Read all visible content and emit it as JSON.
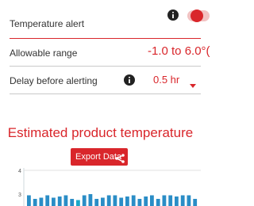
{
  "settings": {
    "alert_label": "Temperature alert",
    "alert_enabled": true,
    "range_label": "Allowable range",
    "range_value": "-1.0 to 6.0°(",
    "delay_label": "Delay before alerting",
    "delay_value": "0.5 hr"
  },
  "chart_section": {
    "title": "Estimated product temperature",
    "export_label": "Export Data"
  },
  "colors": {
    "accent": "#d9262b",
    "bar": "#2a8dc6",
    "bar_low": "#1aa8c8",
    "divider": "#c9c9c9"
  },
  "icons": {
    "info": "info-icon",
    "share": "share-icon",
    "caret": "chevron-down-icon"
  },
  "chart_data": {
    "type": "bar",
    "yticks": [
      "4",
      "3"
    ],
    "ylim": [
      2.7,
      4.2
    ],
    "values": [
      2.95,
      2.8,
      2.85,
      2.95,
      2.85,
      2.9,
      2.95,
      2.8,
      2.75,
      2.95,
      3.0,
      2.8,
      2.85,
      2.95,
      2.95,
      2.85,
      2.9,
      2.95,
      2.8,
      2.9,
      2.95,
      2.8,
      2.95,
      2.95,
      2.9,
      2.95,
      2.95,
      2.8
    ]
  }
}
